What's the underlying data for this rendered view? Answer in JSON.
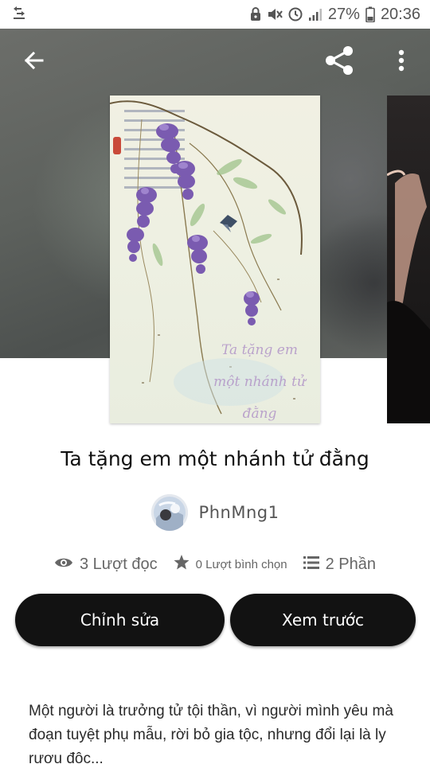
{
  "status_bar": {
    "battery": "27%",
    "time": "20:36",
    "icons": [
      "download-sync-icon",
      "alarm-lock-icon",
      "mute-icon",
      "clock-icon",
      "signal-icon",
      "battery-icon"
    ]
  },
  "toolbar": {
    "icons": [
      "back-arrow-icon",
      "share-icon",
      "more-vert-icon"
    ]
  },
  "cover": {
    "title_lines": [
      "Ta tặng em",
      "một nhánh tử",
      "đằng"
    ]
  },
  "story": {
    "title": "Ta tặng em một nhánh tử đằng",
    "author": "PhnMng1",
    "stats": {
      "reads": "3 Lượt đọc",
      "votes": "0 Lượt bình chọn",
      "parts": "2 Phần"
    },
    "description": "Một người là trưởng tử tội thần, vì người mình yêu mà đoạn tuyệt phụ mẫu, rời bỏ gia tộc, nhưng đổi lại là ly rượu độc..."
  },
  "buttons": {
    "edit": "Chỉnh sửa",
    "preview": "Xem trước"
  }
}
